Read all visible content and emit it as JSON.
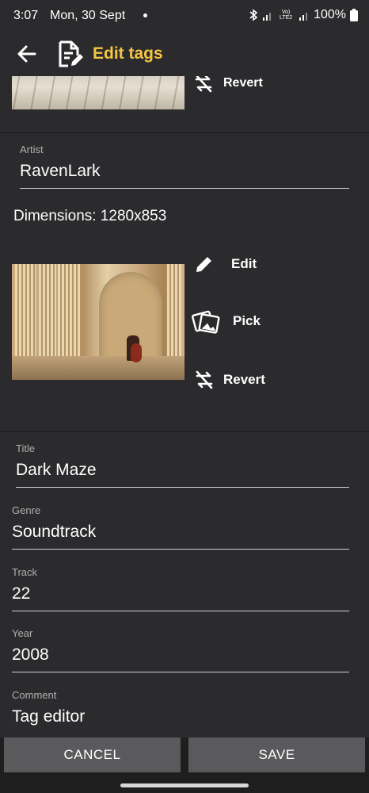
{
  "status_bar": {
    "time": "3:07",
    "date": "Mon, 30 Sept",
    "network": "Vo) LTE2",
    "battery": "100%"
  },
  "app_bar": {
    "title": "Edit tags"
  },
  "top_cover": {
    "revert_label": "Revert"
  },
  "artist": {
    "label": "Artist",
    "value": "RavenLark"
  },
  "dimensions": "Dimensions: 1280x853",
  "cover_actions": {
    "edit_label": "Edit",
    "pick_label": "Pick",
    "revert_label": "Revert"
  },
  "fields": {
    "title": {
      "label": "Title",
      "value": "Dark Maze"
    },
    "genre": {
      "label": "Genre",
      "value": "Soundtrack"
    },
    "track": {
      "label": "Track",
      "value": "22"
    },
    "year": {
      "label": "Year",
      "value": "2008"
    },
    "comment": {
      "label": "Comment",
      "value": "Tag editor"
    }
  },
  "buttons": {
    "cancel": "CANCEL",
    "save": "SAVE"
  },
  "colors": {
    "accent": "#f4c542",
    "background": "#2b2b2d",
    "button": "#5a5a5c"
  }
}
